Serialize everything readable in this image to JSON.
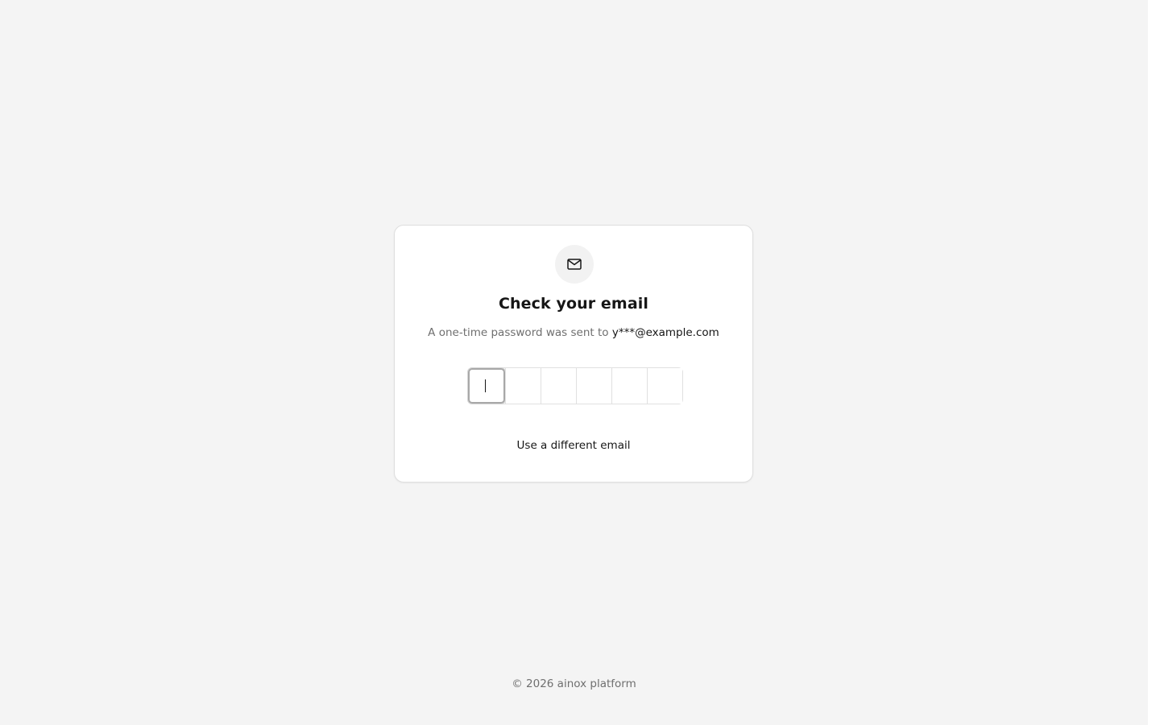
{
  "card": {
    "icon": "mail-icon",
    "title": "Check your email",
    "subtitle_prefix": "A one-time password was sent to ",
    "email": "y***@example.com",
    "otp": {
      "length": 6,
      "values": [
        "",
        "",
        "",
        "",
        "",
        ""
      ],
      "active_index": 0
    },
    "change_email_link": "Use a different email"
  },
  "footer": {
    "text": "© 2026 ainox platform"
  },
  "colors": {
    "background": "#f4f4f4",
    "card": "#ffffff",
    "text_primary": "#161616",
    "text_secondary": "#6f6f6f"
  }
}
